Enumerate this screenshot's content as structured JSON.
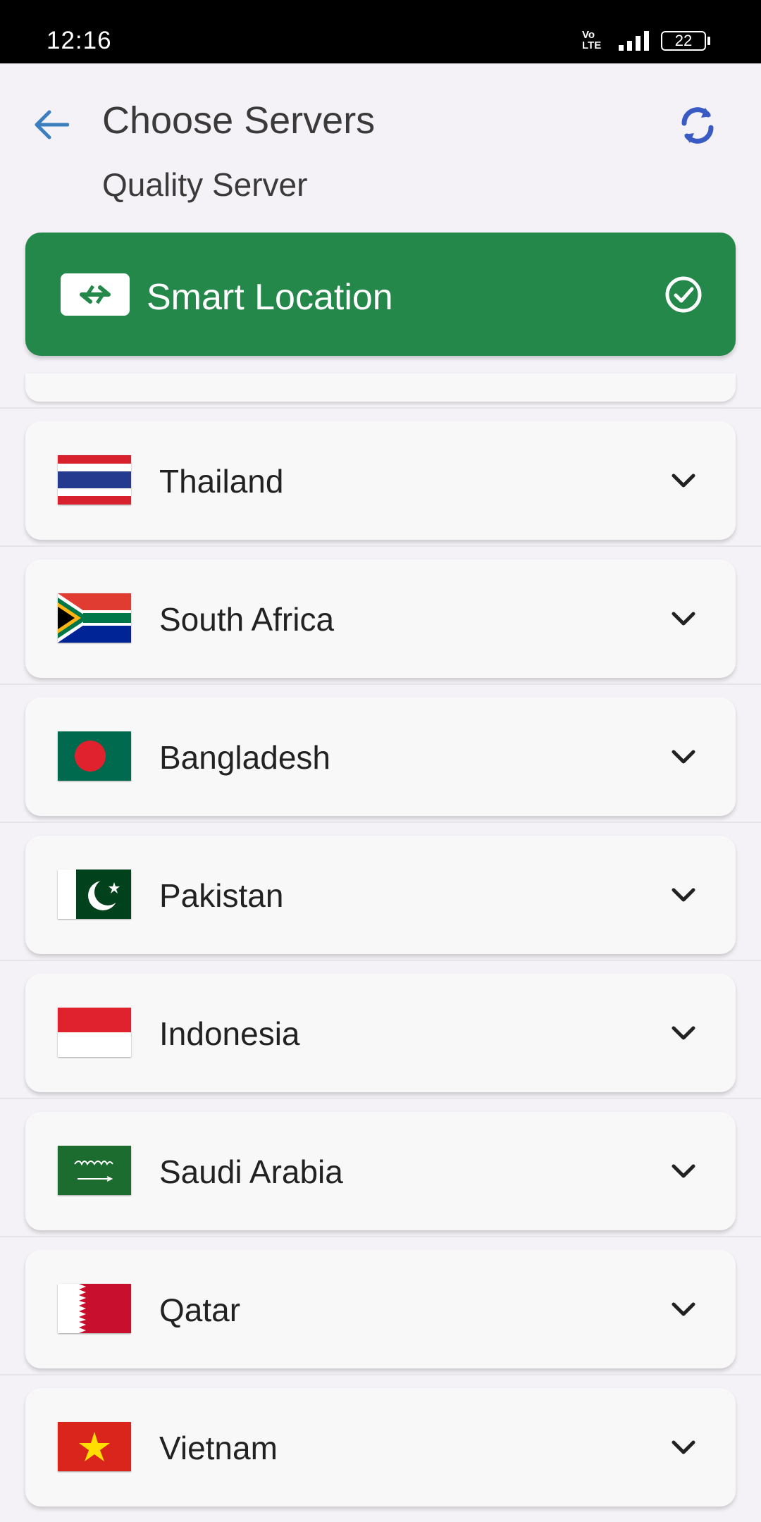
{
  "status_bar": {
    "time": "12:16",
    "network": "Vo LTE",
    "battery": "22"
  },
  "header": {
    "title": "Choose Servers",
    "subtitle": "Quality Server"
  },
  "smart_location": {
    "label": "Smart Location",
    "selected": true,
    "color": "#24884a"
  },
  "servers": [
    {
      "name": "Thailand",
      "flag": "thailand-flag-icon"
    },
    {
      "name": "South Africa",
      "flag": "south-africa-flag-icon"
    },
    {
      "name": "Bangladesh",
      "flag": "bangladesh-flag-icon"
    },
    {
      "name": "Pakistan",
      "flag": "pakistan-flag-icon"
    },
    {
      "name": "Indonesia",
      "flag": "indonesia-flag-icon"
    },
    {
      "name": "Saudi Arabia",
      "flag": "saudi-arabia-flag-icon"
    },
    {
      "name": "Qatar",
      "flag": "qatar-flag-icon"
    },
    {
      "name": "Vietnam",
      "flag": "vietnam-flag-icon"
    }
  ],
  "accent_color": "#3b5bc4"
}
